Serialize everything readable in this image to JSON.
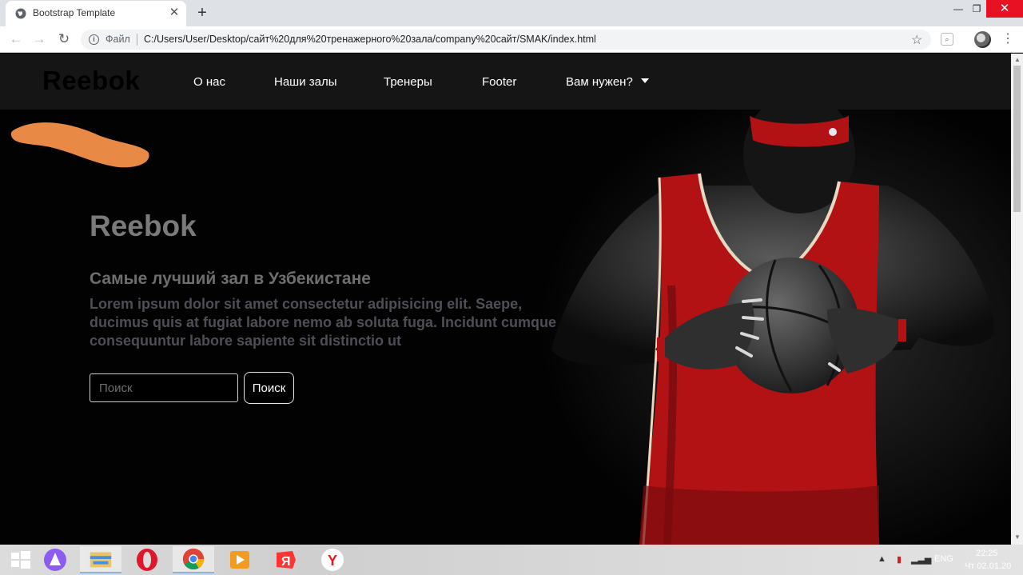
{
  "browser": {
    "tab_title": "Bootstrap Template",
    "tab_close": "✕",
    "new_tab": "+",
    "scheme_label": "Файл",
    "url": "C:/Users/User/Desktop/сайт%20для%20тренажерного%20зала/company%20сайт/SMAK/index.html",
    "window_controls": {
      "minimize": "—",
      "maximize": "❐",
      "close": "✕"
    }
  },
  "navbar": {
    "brand": "Reebok",
    "links": [
      "О нас",
      "Наши залы",
      "Тренеры",
      "Footer",
      "Вам нужен?"
    ]
  },
  "hero": {
    "title": "Reebok",
    "subtitle": "Самые лучший зал в Узбекистане",
    "text": "Lorem ipsum dolor sit amet consectetur adipisicing elit. Saepe, ducimus quis at fugiat labore nemo ab soluta fuga. Incidunt cumque consequuntur labore sapiente sit distinctio ut",
    "search_placeholder": "Поиск",
    "search_button": "Поиск"
  },
  "taskbar": {
    "language": "ENG",
    "time": "22:25",
    "date": "Чт 02.01.20"
  },
  "colors": {
    "accent_orange": "#e88a46",
    "jersey_red": "#b31215",
    "navbar_bg": "#151515"
  }
}
